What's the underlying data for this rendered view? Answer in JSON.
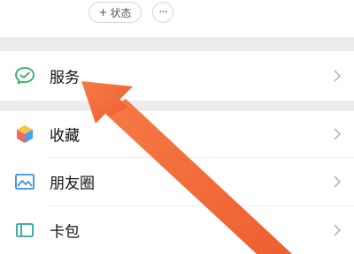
{
  "profile": {
    "status_button_plus": "+",
    "status_button_label": "状态",
    "more_button_label": "···"
  },
  "menu": {
    "items": [
      {
        "label": "服务",
        "icon": "wechat-pay-icon"
      },
      {
        "label": "收藏",
        "icon": "favorites-cube-icon"
      },
      {
        "label": "朋友圈",
        "icon": "moments-picture-icon"
      },
      {
        "label": "卡包",
        "icon": "card-wallet-icon"
      }
    ]
  },
  "annotation": {
    "arrow_color": "#f06a3a",
    "points_to": "服务"
  }
}
